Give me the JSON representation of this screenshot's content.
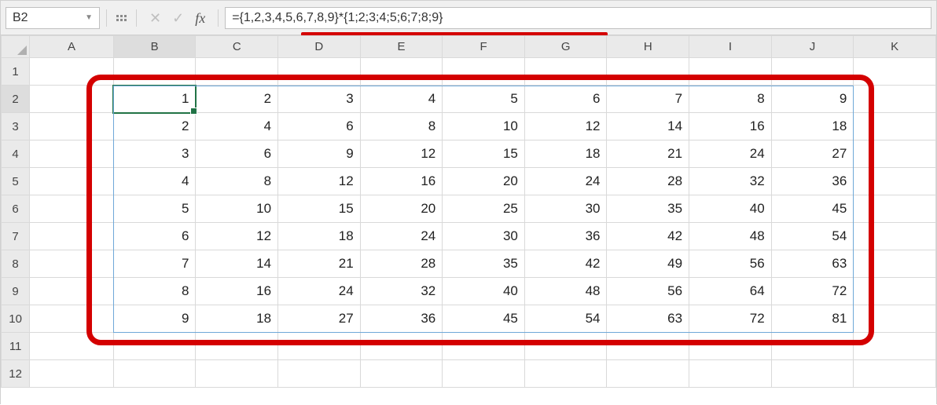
{
  "nameBox": {
    "value": "B2"
  },
  "formulaBar": {
    "cancelGlyph": "✕",
    "enterGlyph": "✓",
    "fxGlyph": "fx",
    "value": "={1,2,3,4,5,6,7,8,9}*{1;2;3;4;5;6;7;8;9}"
  },
  "columns": [
    "A",
    "B",
    "C",
    "D",
    "E",
    "F",
    "G",
    "H",
    "I",
    "J",
    "K"
  ],
  "rows": [
    "1",
    "2",
    "3",
    "4",
    "5",
    "6",
    "7",
    "8",
    "9",
    "10",
    "11",
    "12"
  ],
  "activeCell": {
    "row": 2,
    "colLetter": "B"
  },
  "cells": {
    "B2": "1",
    "C2": "2",
    "D2": "3",
    "E2": "4",
    "F2": "5",
    "G2": "6",
    "H2": "7",
    "I2": "8",
    "J2": "9",
    "B3": "2",
    "C3": "4",
    "D3": "6",
    "E3": "8",
    "F3": "10",
    "G3": "12",
    "H3": "14",
    "I3": "16",
    "J3": "18",
    "B4": "3",
    "C4": "6",
    "D4": "9",
    "E4": "12",
    "F4": "15",
    "G4": "18",
    "H4": "21",
    "I4": "24",
    "J4": "27",
    "B5": "4",
    "C5": "8",
    "D5": "12",
    "E5": "16",
    "F5": "20",
    "G5": "24",
    "H5": "28",
    "I5": "32",
    "J5": "36",
    "B6": "5",
    "C6": "10",
    "D6": "15",
    "E6": "20",
    "F6": "25",
    "G6": "30",
    "H6": "35",
    "I6": "40",
    "J6": "45",
    "B7": "6",
    "C7": "12",
    "D7": "18",
    "E7": "24",
    "F7": "30",
    "G7": "36",
    "H7": "42",
    "I7": "48",
    "J7": "54",
    "B8": "7",
    "C8": "14",
    "D8": "21",
    "E8": "28",
    "F8": "35",
    "G8": "42",
    "H8": "49",
    "I8": "56",
    "J8": "63",
    "B9": "8",
    "C9": "16",
    "D9": "24",
    "E9": "32",
    "F9": "40",
    "G9": "48",
    "H9": "56",
    "I9": "64",
    "J9": "72",
    "B10": "9",
    "C10": "18",
    "D10": "27",
    "E10": "36",
    "F10": "45",
    "G10": "54",
    "H10": "63",
    "I10": "72",
    "J10": "81"
  },
  "spillRange": {
    "from": "B2",
    "to": "J10"
  },
  "annotation": {
    "underlineFormula": true,
    "redRectAroundSpill": true
  }
}
